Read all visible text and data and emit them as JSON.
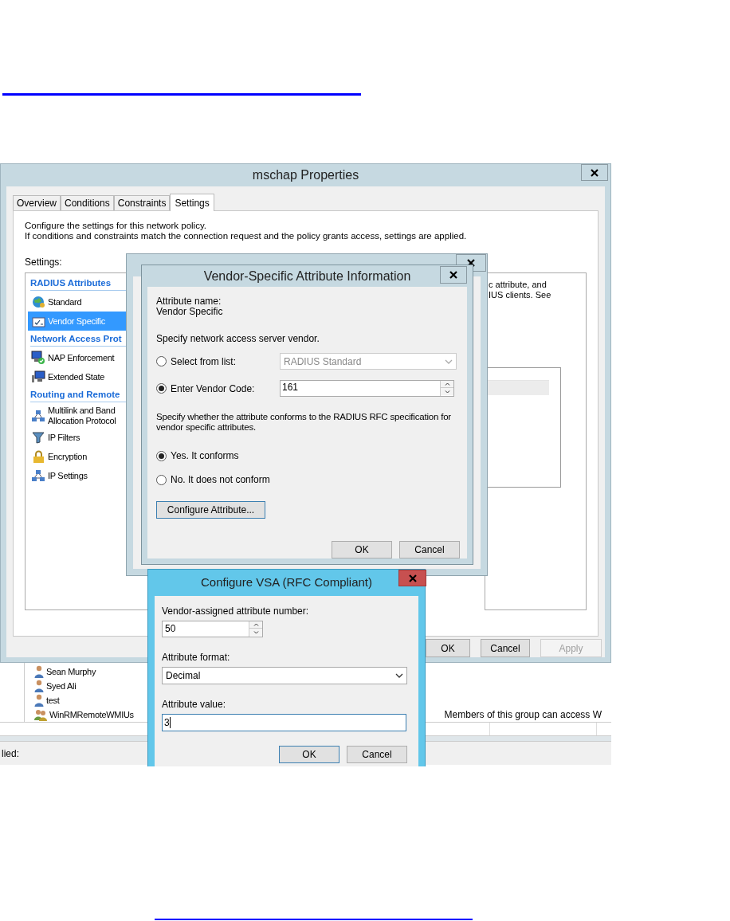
{
  "main_window": {
    "title": "mschap Properties",
    "tabs": [
      {
        "label": "Overview",
        "selected": false
      },
      {
        "label": "Conditions",
        "selected": false
      },
      {
        "label": "Constraints",
        "selected": false
      },
      {
        "label": "Settings",
        "selected": true
      }
    ],
    "description": [
      "Configure the settings for this network policy.",
      "If conditions and constraints match the connection request and the policy grants access, settings are applied."
    ],
    "settings_label": "Settings:",
    "settings_tree": [
      {
        "label": "RADIUS Attributes",
        "children": [
          {
            "label": "Standard",
            "selected": false
          },
          {
            "label": "Vendor Specific",
            "selected": true
          }
        ]
      },
      {
        "label": "Network Access Prot",
        "children": [
          {
            "label": "NAP Enforcement",
            "selected": false
          },
          {
            "label": "Extended State",
            "selected": false
          }
        ]
      },
      {
        "label": "Routing and Remote",
        "children": [
          {
            "label": "Multilink and Band\nAllocation Protocol",
            "selected": false
          },
          {
            "label": "IP Filters",
            "selected": false
          },
          {
            "label": "Encryption",
            "selected": false
          },
          {
            "label": "IP Settings",
            "selected": false
          }
        ]
      }
    ],
    "details_text": [
      "c attribute, and",
      "IUS clients. See"
    ],
    "buttons": [
      {
        "label": "OK",
        "disabled": false
      },
      {
        "label": "Cancel",
        "disabled": false
      },
      {
        "label": "Apply",
        "disabled": true
      }
    ]
  },
  "vendor_dialog": {
    "title": "Vendor-Specific Attribute Information",
    "attribute_name_label": "Attribute name:",
    "attribute_name": "Vendor Specific",
    "vendor_prompt": "Specify network access server vendor.",
    "vendor_options": [
      {
        "label": "Select from list:",
        "selected": false,
        "kind": "dropdown",
        "value": "RADIUS Standard"
      },
      {
        "label": "Enter Vendor Code:",
        "selected": true,
        "kind": "spinner",
        "value": "161"
      }
    ],
    "conform_prompt": "Specify whether the attribute conforms to the RADIUS RFC specification for vendor specific attributes.",
    "conform_options": [
      {
        "label": "Yes. It conforms",
        "selected": true
      },
      {
        "label": "No. It does not conform",
        "selected": false
      }
    ],
    "configure_button": "Configure Attribute...",
    "buttons": [
      "OK",
      "Cancel"
    ]
  },
  "vsa_dialog": {
    "title": "Configure VSA (RFC Compliant)",
    "fields": [
      {
        "label": "Vendor-assigned attribute number:",
        "kind": "spinner",
        "value": "50",
        "focused": false
      },
      {
        "label": "Attribute format:",
        "kind": "dropdown",
        "value": "Decimal",
        "focused": false
      },
      {
        "label": "Attribute value:",
        "kind": "text",
        "value": "3",
        "focused": true
      }
    ],
    "buttons": [
      "OK",
      "Cancel"
    ]
  },
  "background_list": {
    "rows": [
      {
        "name": "Sean Murphy"
      },
      {
        "name": "Syed Ali"
      },
      {
        "name": "test"
      },
      {
        "name": "WinRMRemoteWMIUs",
        "description": "Members of this group can access W"
      }
    ]
  },
  "status_bar": "lied:"
}
